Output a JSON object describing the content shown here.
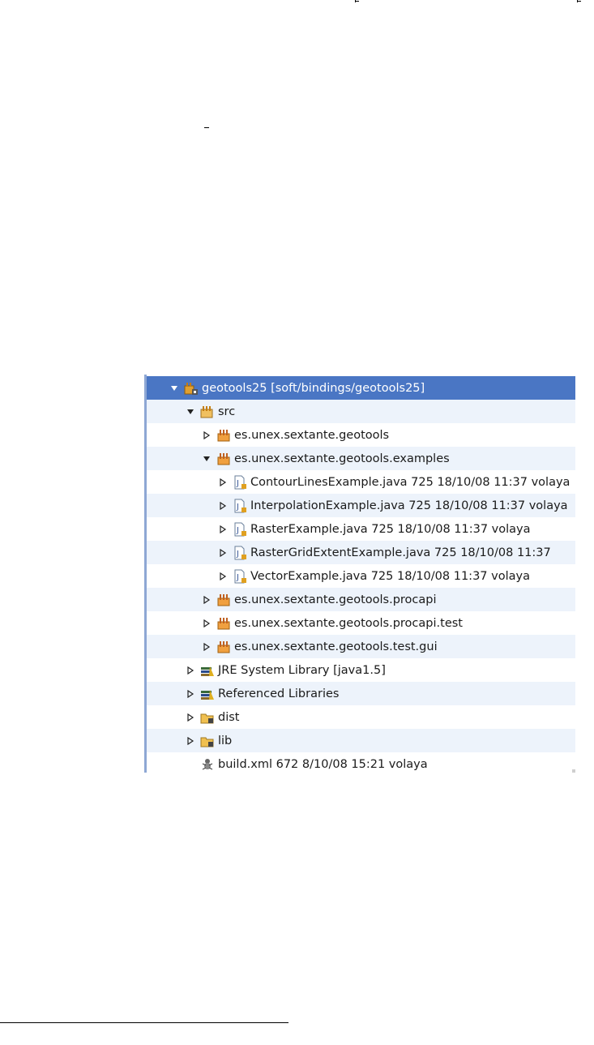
{
  "tree": {
    "rows": [
      {
        "label": "geotools25 [soft/bindings/geotools25]",
        "icon": "java-project-icon",
        "state": "expanded",
        "depth": 0,
        "selected": true
      },
      {
        "label": "src",
        "icon": "source-folder-icon",
        "state": "expanded",
        "depth": 1
      },
      {
        "label": "es.unex.sextante.geotools",
        "icon": "package-icon",
        "state": "collapsed",
        "depth": 2
      },
      {
        "label": "es.unex.sextante.geotools.examples",
        "icon": "package-icon",
        "state": "expanded",
        "depth": 2
      },
      {
        "label": "ContourLinesExample.java 725  18/10/08 11:37  volaya",
        "icon": "java-file-icon",
        "state": "collapsed",
        "depth": 3
      },
      {
        "label": "InterpolationExample.java 725  18/10/08 11:37  volaya",
        "icon": "java-file-icon",
        "state": "collapsed",
        "depth": 3
      },
      {
        "label": "RasterExample.java 725  18/10/08 11:37  volaya",
        "icon": "java-file-icon",
        "state": "collapsed",
        "depth": 3
      },
      {
        "label": "RasterGridExtentExample.java 725  18/10/08 11:37",
        "icon": "java-file-icon",
        "state": "collapsed",
        "depth": 3
      },
      {
        "label": "VectorExample.java 725  18/10/08 11:37  volaya",
        "icon": "java-file-icon",
        "state": "collapsed",
        "depth": 3
      },
      {
        "label": "es.unex.sextante.geotools.procapi",
        "icon": "package-icon",
        "state": "collapsed",
        "depth": 2
      },
      {
        "label": "es.unex.sextante.geotools.procapi.test",
        "icon": "package-icon",
        "state": "collapsed",
        "depth": 2
      },
      {
        "label": "es.unex.sextante.geotools.test.gui",
        "icon": "package-icon",
        "state": "collapsed",
        "depth": 2
      },
      {
        "label": "JRE System Library [java1.5]",
        "icon": "library-icon",
        "state": "collapsed",
        "depth": 1
      },
      {
        "label": "Referenced Libraries",
        "icon": "library-icon",
        "state": "collapsed",
        "depth": 1
      },
      {
        "label": "dist",
        "icon": "folder-icon",
        "state": "collapsed",
        "depth": 1
      },
      {
        "label": "lib",
        "icon": "folder-icon",
        "state": "collapsed",
        "depth": 1
      },
      {
        "label": "build.xml 672  8/10/08 15:21  volaya",
        "icon": "ant-file-icon",
        "state": "leaf",
        "depth": 1
      }
    ]
  },
  "colors": {
    "selection": "#4a76c4",
    "alt_row": "#edf3fb",
    "panel_border": "#8ea7d4"
  }
}
